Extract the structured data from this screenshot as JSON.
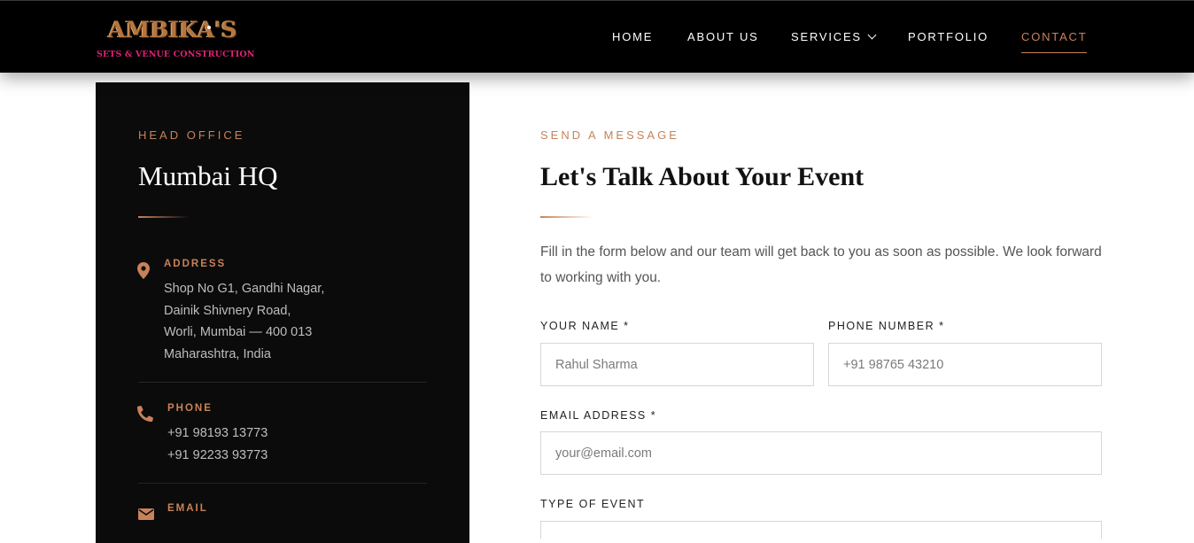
{
  "brand": {
    "logo_text": "AMBIKA'S",
    "logo_tagline": "SETS & VENUE CONSTRUCTION"
  },
  "nav": {
    "items": [
      {
        "label": "HOME"
      },
      {
        "label": "ABOUT US"
      },
      {
        "label": "SERVICES"
      },
      {
        "label": "PORTFOLIO"
      },
      {
        "label": "CONTACT"
      }
    ],
    "active": "CONTACT"
  },
  "office": {
    "kicker": "HEAD OFFICE",
    "title": "Mumbai HQ",
    "address": {
      "label": "ADDRESS",
      "lines": [
        "Shop No G1, Gandhi Nagar,",
        "Dainik Shivnery Road,",
        "Worli, Mumbai — 400 013",
        "Maharashtra, India"
      ]
    },
    "phone": {
      "label": "PHONE",
      "lines": [
        "+91 98193 13773",
        "+91 92233 93773"
      ]
    },
    "email": {
      "label": "EMAIL"
    }
  },
  "form": {
    "kicker": "SEND A MESSAGE",
    "title": "Let's Talk About Your Event",
    "intro": "Fill in the form below and our team will get back to you as soon as possible. We look forward to working with you.",
    "fields": {
      "name": {
        "label": "YOUR NAME *",
        "placeholder": "Rahul Sharma"
      },
      "phone": {
        "label": "PHONE NUMBER *",
        "placeholder": "+91 98765 43210"
      },
      "email": {
        "label": "EMAIL ADDRESS *",
        "placeholder": "your@email.com"
      },
      "event_type": {
        "label": "TYPE OF EVENT"
      }
    }
  },
  "colors": {
    "accent": "#c8825a",
    "nav_bg": "#000000",
    "panel_bg": "#0b0b0b",
    "logo_pink": "#e0207a"
  }
}
